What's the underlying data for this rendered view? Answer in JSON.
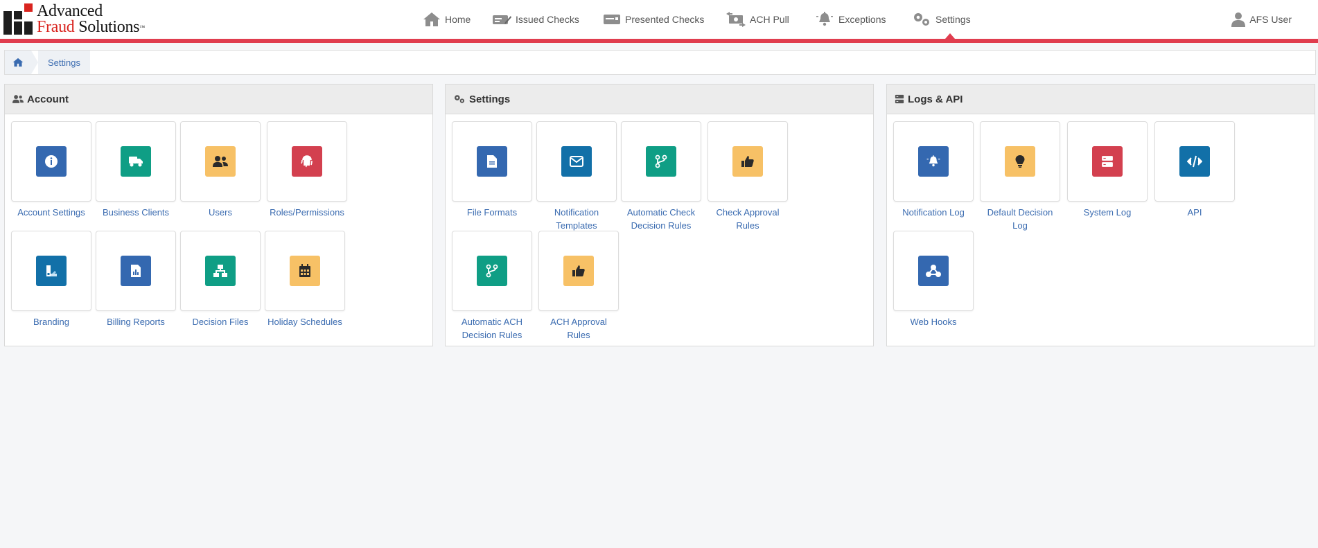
{
  "brand": {
    "line1": "Advanced",
    "line2a": "Fraud",
    "line2b": "Solutions",
    "tm": "™"
  },
  "colors": {
    "blue": "#3468b0",
    "teal": "#0f9e85",
    "yellow": "#f7c166",
    "red": "#d3404f",
    "darkblue": "#1270a8",
    "accent": "#e03d4f",
    "link": "#3a6bb0"
  },
  "nav": {
    "items": [
      {
        "label": "Home",
        "icon": "home-icon"
      },
      {
        "label": "Issued Checks",
        "icon": "pen-check-icon"
      },
      {
        "label": "Presented Checks",
        "icon": "check-card-icon"
      },
      {
        "label": "ACH Pull",
        "icon": "money-transfer-icon"
      },
      {
        "label": "Exceptions",
        "icon": "bell-icon"
      },
      {
        "label": "Settings",
        "icon": "gears-icon",
        "active": true
      }
    ],
    "user": "AFS User"
  },
  "breadcrumb": {
    "current": "Settings"
  },
  "panels": [
    {
      "title": "Account",
      "icon": "users-icon",
      "tiles": [
        {
          "label": "Account Settings",
          "icon": "info-icon",
          "color": "blue"
        },
        {
          "label": "Business Clients",
          "icon": "truck-icon",
          "color": "teal"
        },
        {
          "label": "Users",
          "icon": "users-icon",
          "color": "yellow"
        },
        {
          "label": "Roles/Permissions",
          "icon": "fingerprint-icon",
          "color": "red"
        },
        {
          "label": "Branding",
          "icon": "palette-icon",
          "color": "darkblue"
        },
        {
          "label": "Billing Reports",
          "icon": "report-icon",
          "color": "blue"
        },
        {
          "label": "Decision Files",
          "icon": "sitemap-icon",
          "color": "teal"
        },
        {
          "label": "Holiday Schedules",
          "icon": "calendar-icon",
          "color": "yellow"
        }
      ]
    },
    {
      "title": "Settings",
      "icon": "gears-icon",
      "tiles": [
        {
          "label": "File Formats",
          "icon": "file-icon",
          "color": "blue"
        },
        {
          "label": "Notification Templates",
          "icon": "envelope-icon",
          "color": "darkblue"
        },
        {
          "label": "Automatic Check Decision Rules",
          "icon": "code-branch-icon",
          "color": "teal"
        },
        {
          "label": "Check Approval Rules",
          "icon": "thumbs-up-icon",
          "color": "yellow"
        },
        {
          "label": "Automatic ACH Decision Rules",
          "icon": "code-branch-icon",
          "color": "teal"
        },
        {
          "label": "ACH Approval Rules",
          "icon": "thumbs-up-icon",
          "color": "yellow"
        }
      ]
    },
    {
      "title": "Logs & API",
      "icon": "server-icon",
      "tiles": [
        {
          "label": "Notification Log",
          "icon": "bell-icon",
          "color": "blue"
        },
        {
          "label": "Default Decision Log",
          "icon": "lightbulb-icon",
          "color": "yellow"
        },
        {
          "label": "System Log",
          "icon": "server-icon",
          "color": "red"
        },
        {
          "label": "API",
          "icon": "code-icon",
          "color": "darkblue"
        },
        {
          "label": "Web Hooks",
          "icon": "webhook-icon",
          "color": "blue"
        }
      ]
    }
  ]
}
